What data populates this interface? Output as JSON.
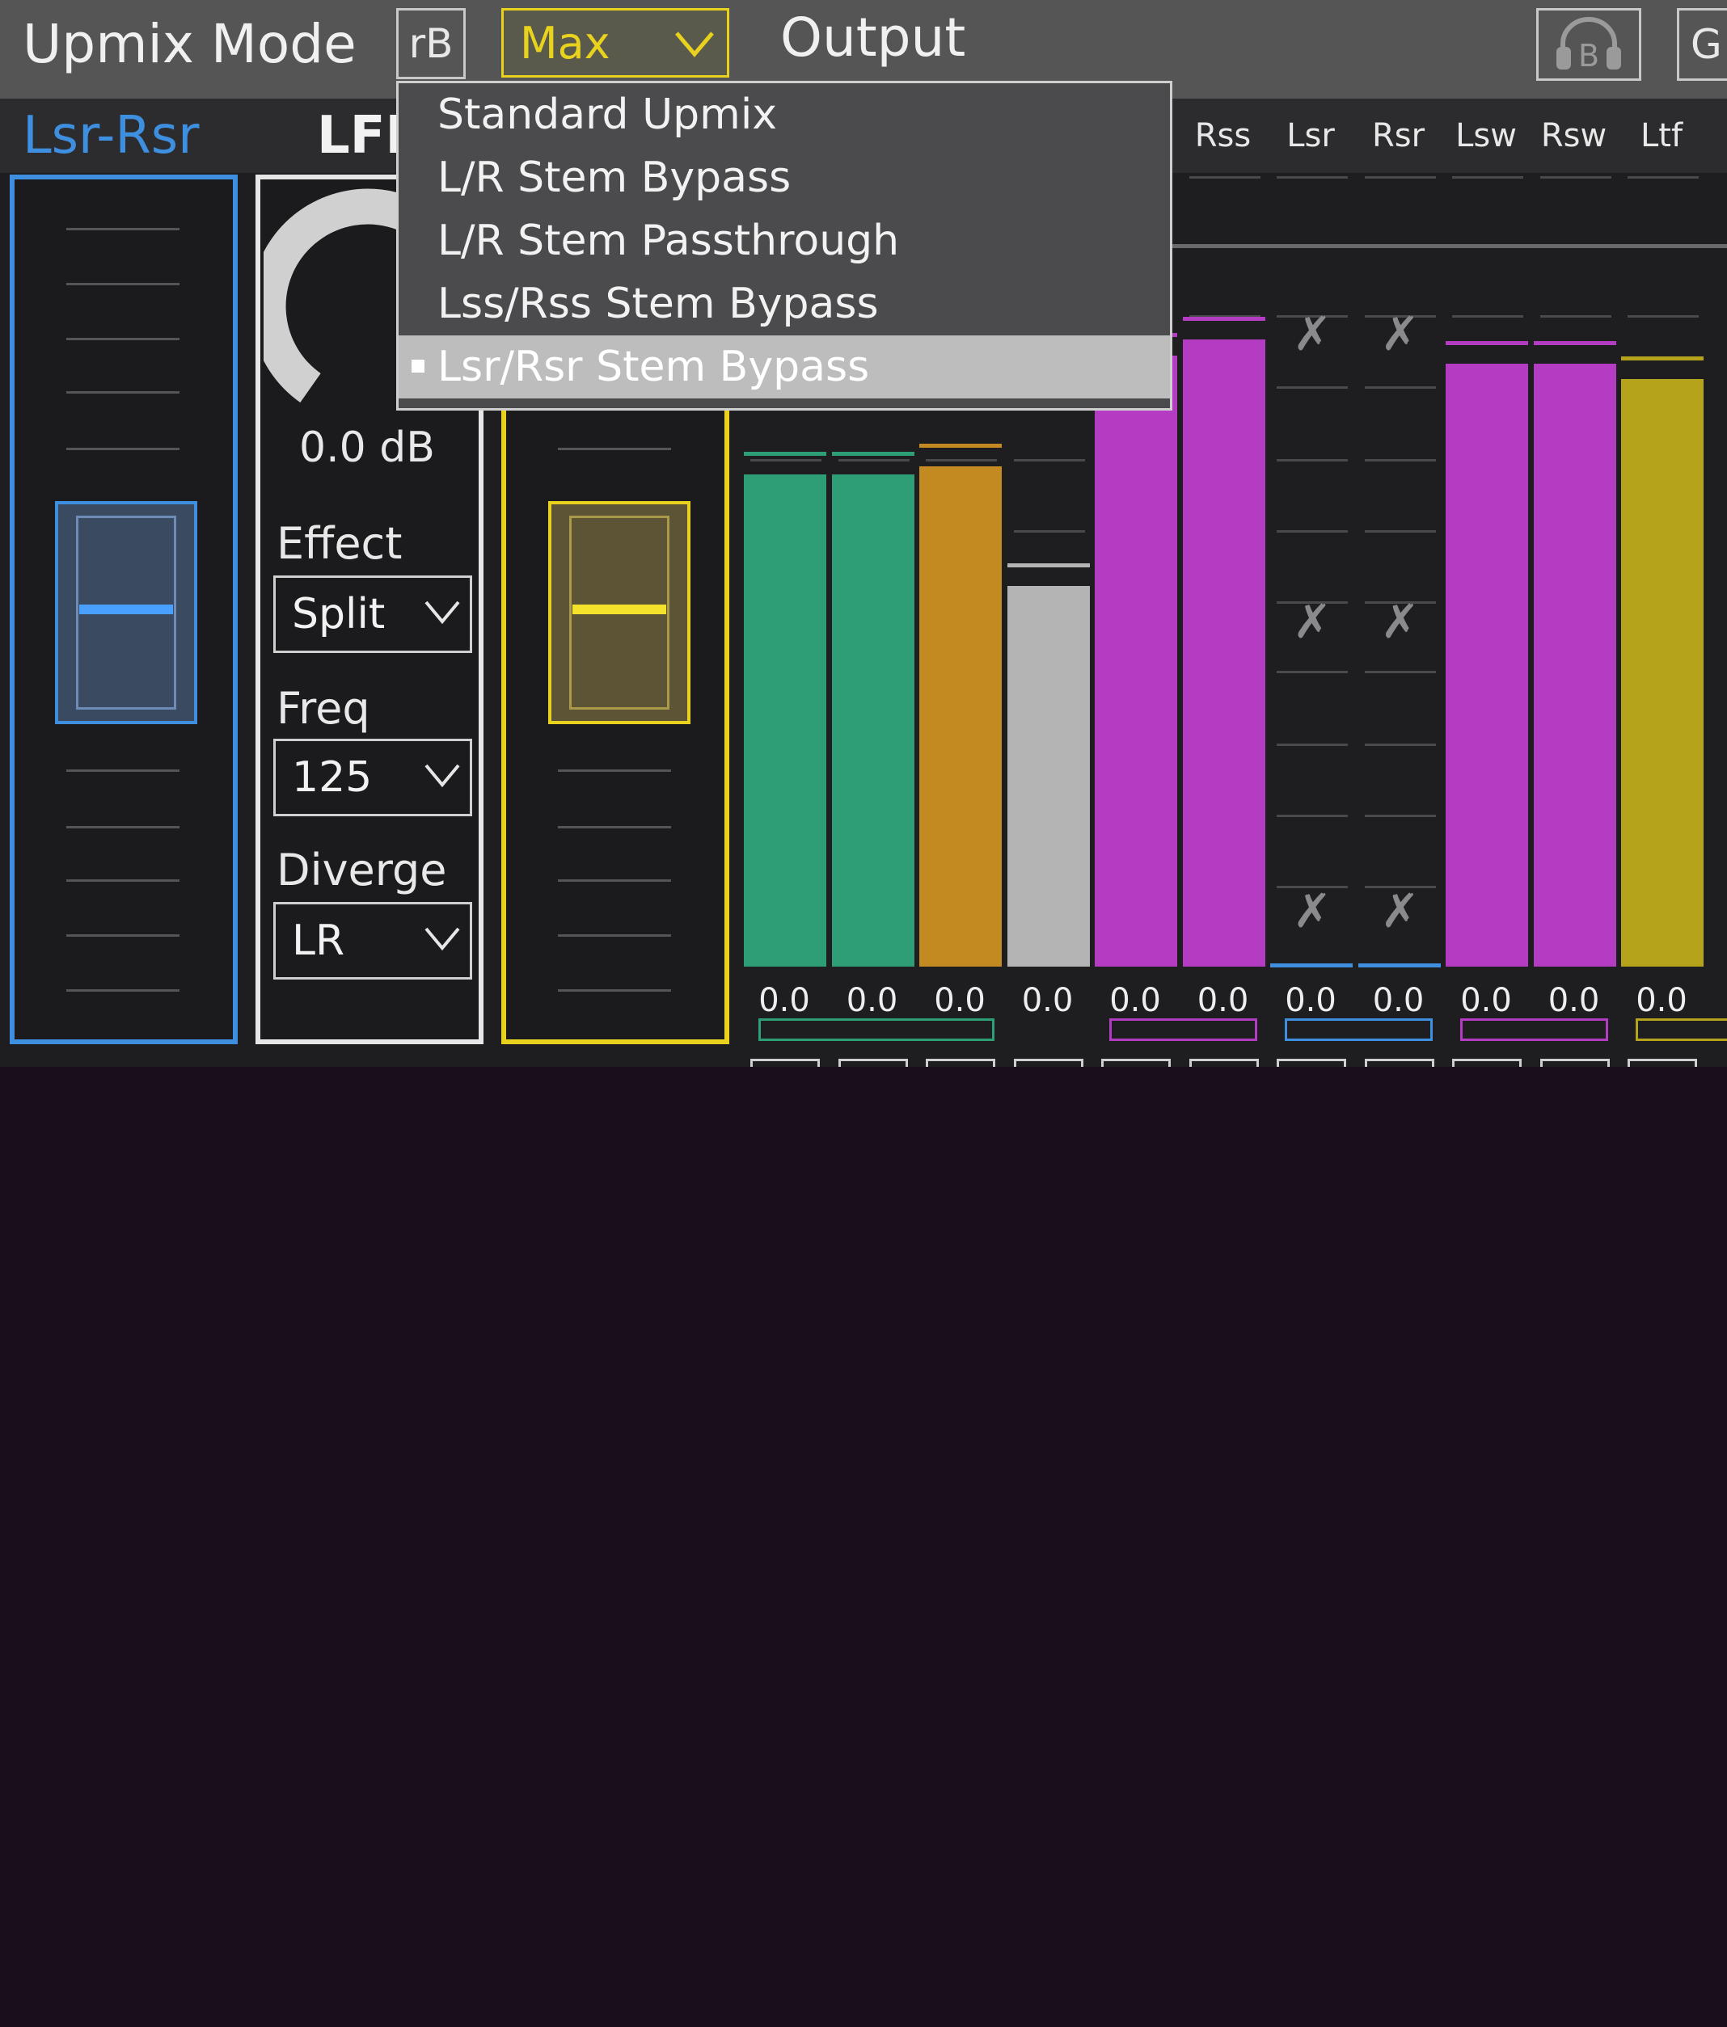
{
  "header": {
    "title": "Upmix Mode",
    "rb_button": "rB",
    "mode_value": "Max",
    "output_label": "Output",
    "headphone_button_text": "B",
    "right_button_text": "G"
  },
  "colors": {
    "blue": "#3e8fe0",
    "yellow": "#e9d21e",
    "green": "#2e9e77",
    "orange": "#c48a22",
    "gray": "#b4b4b4",
    "magenta": "#b43cc2",
    "olive": "#b6a31c"
  },
  "left_panel": {
    "title": "Lsr-Rsr"
  },
  "lfe_panel": {
    "title": "LFE",
    "gain": "0.0 dB",
    "effect_label": "Effect",
    "effect_value": "Split",
    "freq_label": "Freq",
    "freq_value": "125",
    "diverge_label": "Diverge",
    "diverge_value": "LR"
  },
  "channels": [
    {
      "label": "",
      "value": "0.0",
      "level": 0.62,
      "color": "green"
    },
    {
      "label": "",
      "value": "0.0",
      "level": 0.62,
      "color": "green"
    },
    {
      "label": "",
      "value": "0.0",
      "level": 0.63,
      "color": "orange"
    },
    {
      "label": "",
      "value": "0.0",
      "level": 0.48,
      "color": "gray"
    },
    {
      "label": "",
      "value": "0.0",
      "level": 0.77,
      "color": "magenta"
    },
    {
      "label": "Rss",
      "value": "0.0",
      "level": 0.79,
      "color": "magenta"
    },
    {
      "label": "Lsr",
      "value": "0.0",
      "level": 0,
      "color": "blue"
    },
    {
      "label": "Rsr",
      "value": "0.0",
      "level": 0,
      "color": "blue"
    },
    {
      "label": "Lsw",
      "value": "0.0",
      "level": 0.76,
      "color": "magenta"
    },
    {
      "label": "Rsw",
      "value": "0.0",
      "level": 0.76,
      "color": "magenta"
    },
    {
      "label": "Ltf",
      "value": "0.0",
      "level": 0.74,
      "color": "olive"
    }
  ],
  "menu": {
    "items": [
      {
        "label": "Standard Upmix",
        "selected": false
      },
      {
        "label": "L/R Stem Bypass",
        "selected": false
      },
      {
        "label": "L/R Stem Passthrough",
        "selected": false
      },
      {
        "label": "Lss/Rss Stem Bypass",
        "selected": false
      },
      {
        "label": "Lsr/Rsr Stem Bypass",
        "selected": true
      }
    ]
  }
}
